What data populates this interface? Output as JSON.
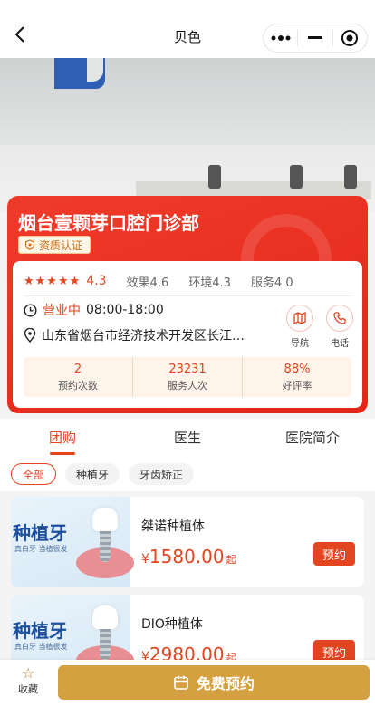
{
  "header": {
    "title": "贝色"
  },
  "clinic": {
    "name": "烟台壹颗芽口腔门诊部",
    "cert_label": "资质认证",
    "stars": "★★★★★",
    "rating": "4.3",
    "sub_scores": [
      "效果4.6",
      "环境4.3",
      "服务4.0"
    ],
    "status": "营业中",
    "hours": "08:00-18:00",
    "address": "山东省烟台市经济技术开发区长江…",
    "actions": {
      "nav": "导航",
      "phone": "电话"
    },
    "stats": [
      {
        "value": "2",
        "label": "预约次数"
      },
      {
        "value": "23231",
        "label": "服务人次"
      },
      {
        "value": "88%",
        "label": "好评率"
      }
    ]
  },
  "tabs": [
    "团购",
    "医生",
    "医院简介"
  ],
  "chips": [
    "全部",
    "种植牙",
    "牙齿矫正"
  ],
  "products": [
    {
      "image_title": "种植牙",
      "image_sub": "真白牙 当植很发",
      "name": "桀诺种植体",
      "currency": "¥",
      "price": "1580.00",
      "suffix": "起",
      "book": "预约"
    },
    {
      "image_title": "种植牙",
      "image_sub": "真白牙 当植很发",
      "name": "DIO种植体",
      "currency": "¥",
      "price": "2980.00",
      "suffix": "起",
      "book": "预约"
    }
  ],
  "bottom": {
    "fav_label": "收藏",
    "free_booking": "免费预约"
  },
  "colors": {
    "accent": "#e2451f",
    "gold": "#d4a040"
  }
}
